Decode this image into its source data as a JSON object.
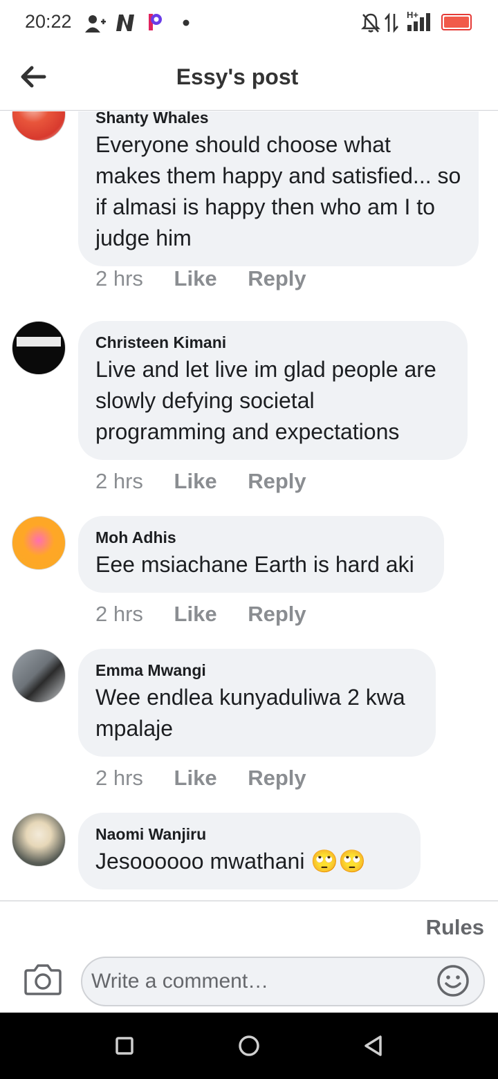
{
  "status_bar": {
    "time": "20:22",
    "network_label": "H+",
    "battery_color": "#f15a4a"
  },
  "header": {
    "title": "Essy's post",
    "back_icon": "arrow-left-icon"
  },
  "comments": [
    {
      "author": "Shanty Whales",
      "text": "Everyone should choose what makes them happy and satisfied... so if almasi is happy then who am I to judge him",
      "time": "2 hrs",
      "like_label": "Like",
      "reply_label": "Reply"
    },
    {
      "author": "Christeen Kimani",
      "text": "Live and let live im glad people are slowly defying societal programming and expectations",
      "time": "2 hrs",
      "like_label": "Like",
      "reply_label": "Reply"
    },
    {
      "author": "Moh Adhis",
      "text": "Eee msiachane Earth is hard aki",
      "time": "2 hrs",
      "like_label": "Like",
      "reply_label": "Reply"
    },
    {
      "author": "Emma Mwangi",
      "text": "Wee endlea kunyaduliwa 2 kwa mpalaje",
      "time": "2 hrs",
      "like_label": "Like",
      "reply_label": "Reply"
    },
    {
      "author": "Naomi Wanjiru",
      "text": "Jesoooooo mwathani 🙄🙄"
    }
  ],
  "composer": {
    "rules_label": "Rules",
    "placeholder": "Write a comment…",
    "camera_icon": "camera-icon",
    "emoji_icon": "smiley-icon"
  },
  "nav": {
    "recents_icon": "square-icon",
    "home_icon": "circle-icon",
    "back_icon": "triangle-back-icon"
  },
  "colors": {
    "bubble_bg": "#f0f2f5",
    "meta_text": "#8a8d91",
    "rules_text": "#65676b"
  }
}
